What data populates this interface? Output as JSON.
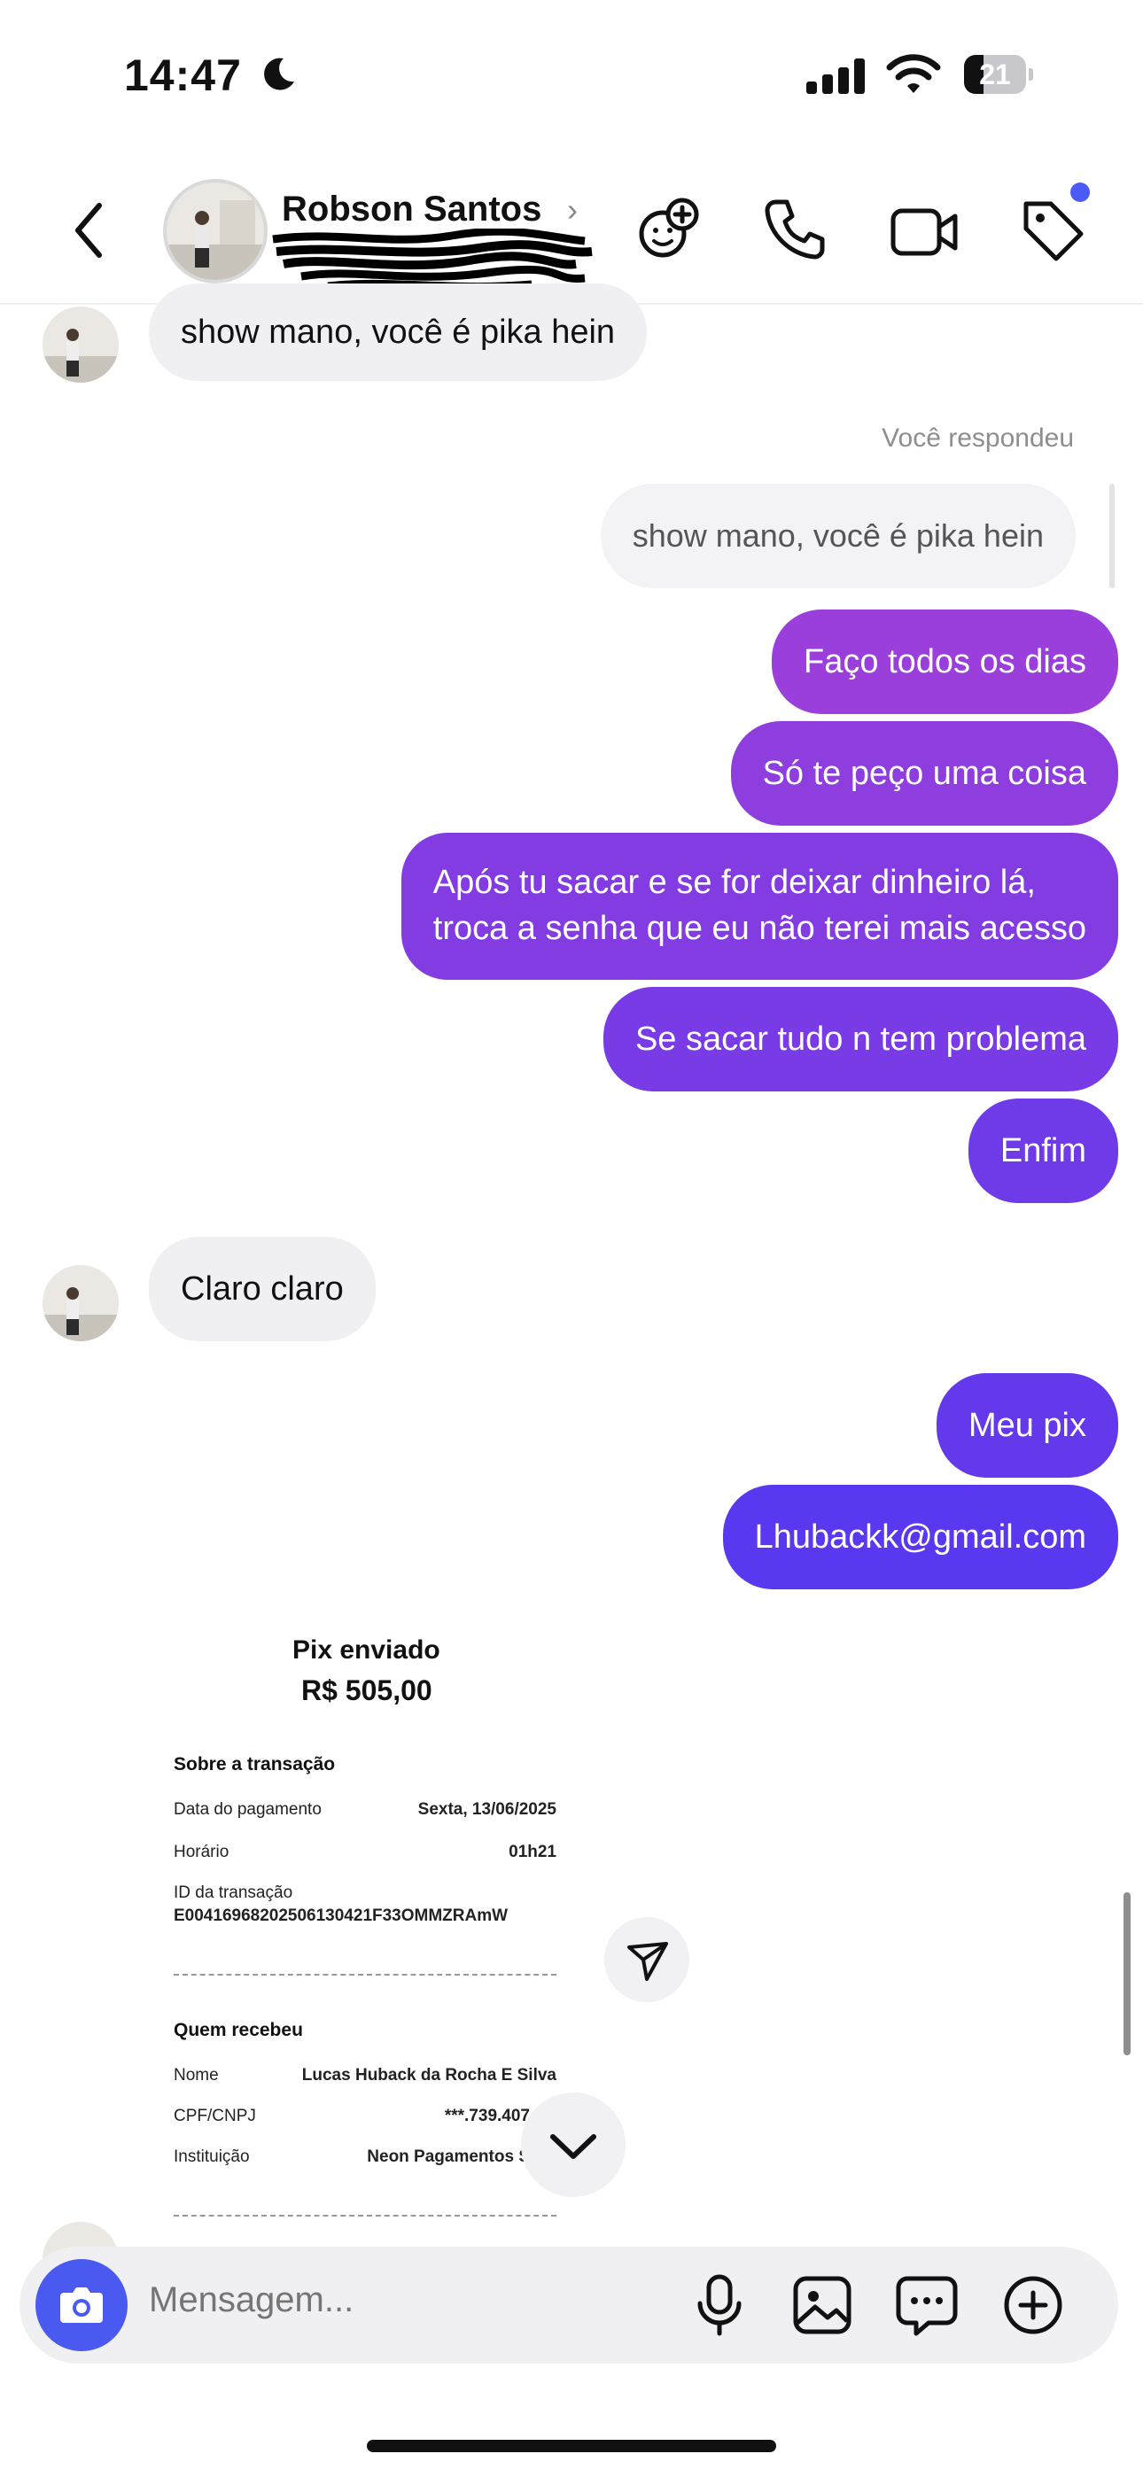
{
  "status_bar": {
    "time": "14:47",
    "battery": "21",
    "moon_icon": "moon-icon",
    "signal_icon": "cellular-signal-icon",
    "wifi_icon": "wifi-icon"
  },
  "header": {
    "contact_name": "Robson Santos",
    "icons": [
      "back-chevron-icon",
      "add-sticker-icon",
      "phone-icon",
      "video-camera-icon",
      "tag-icon"
    ],
    "notification_dot_color": "#4a5cf5"
  },
  "messages": {
    "incoming_1": "show mano, você é pika hein",
    "replied_label": "Você respondeu",
    "reply_quote": "show mano, você é pika hein",
    "outgoing": [
      "Faço todos os dias",
      "Só te peço uma coisa",
      "Após tu sacar e se for deixar dinheiro lá,",
      "troca a senha que eu não terei mais acesso",
      "Se sacar tudo n tem problema",
      "Enfim"
    ],
    "incoming_2": "Claro claro",
    "outgoing_2": [
      "Meu pix",
      "Lhubackk@gmail.com"
    ]
  },
  "receipt": {
    "title": "Pix enviado",
    "amount": "R$ 505,00",
    "section_transaction": "Sobre a transação",
    "payment_date_label": "Data do pagamento",
    "payment_date_value": "Sexta, 13/06/2025",
    "time_label": "Horário",
    "time_value": "01h21",
    "transaction_id_label": "ID da transação",
    "transaction_id_value": "E00416968202506130421F33OMMZRAmW",
    "section_receiver": "Quem recebeu",
    "name_label": "Nome",
    "name_value": "Lucas Huback da Rocha E Silva",
    "cpf_label": "CPF/CNPJ",
    "cpf_value": "***.739.407",
    "institution_label": "Instituição",
    "institution_value": "Neon Pagamentos S"
  },
  "composer": {
    "placeholder": "Mensagem...",
    "icons": [
      "camera-icon",
      "microphone-icon",
      "gallery-icon",
      "sticker-chat-icon",
      "plus-circle-icon"
    ]
  },
  "colors": {
    "outgoing_gradient_top": "#9b3fdc",
    "outgoing_gradient_bottom": "#5b3bf0",
    "incoming_bubble": "#f0f0f2",
    "camera_button": "#4a5af0"
  }
}
